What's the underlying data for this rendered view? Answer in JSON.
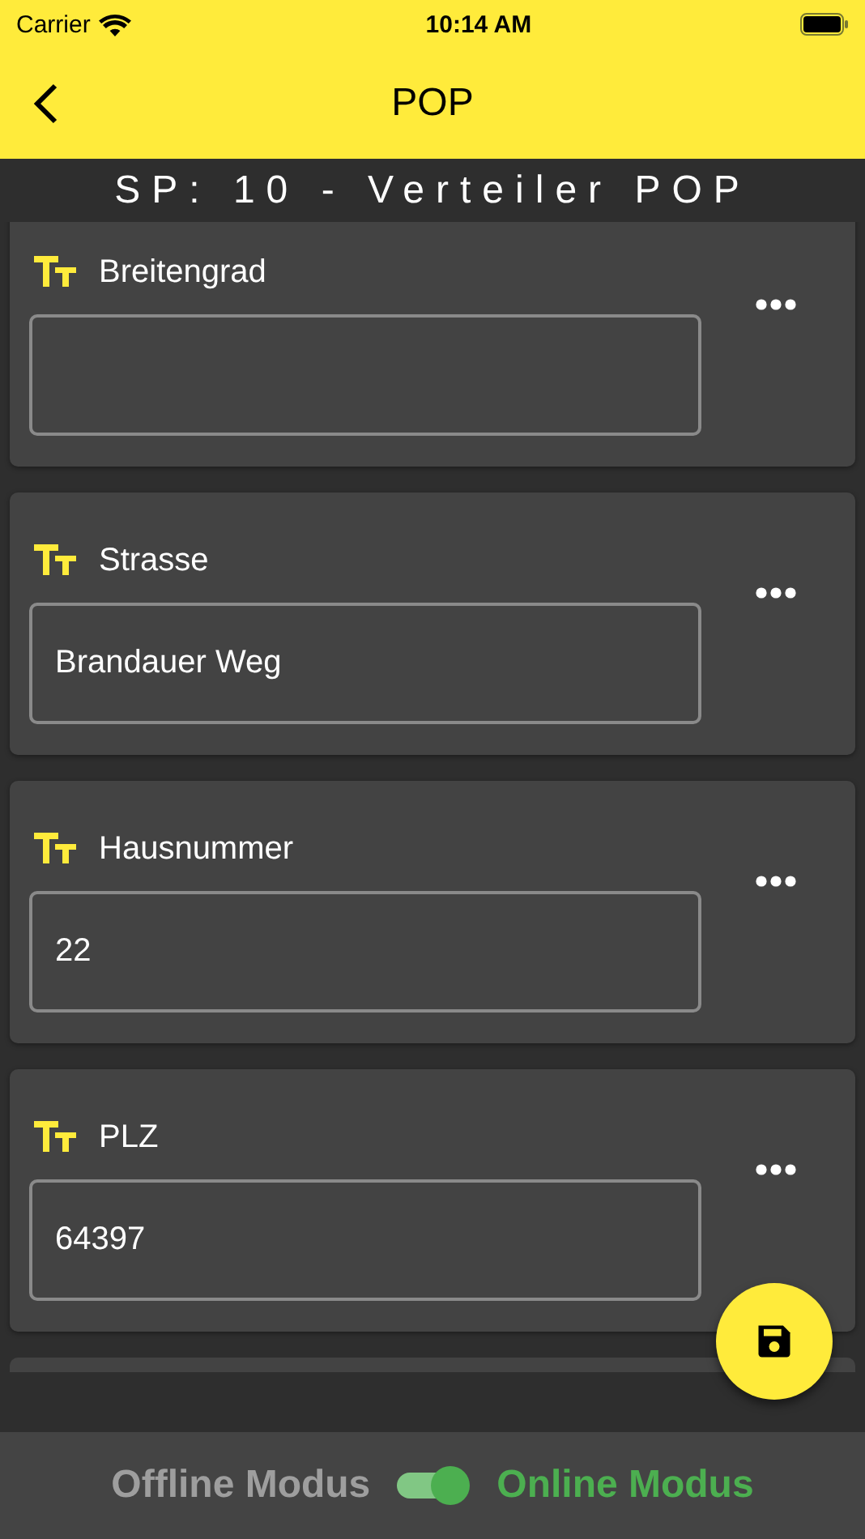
{
  "status_bar": {
    "carrier": "Carrier",
    "time": "10:14 AM"
  },
  "nav": {
    "title": "POP"
  },
  "subtitle": "SP: 10 - Verteiler POP",
  "fields": [
    {
      "label": "Breitengrad"
    },
    {
      "label": "Strasse",
      "value": "Brandauer Weg"
    },
    {
      "label": "Hausnummer",
      "value": "22"
    },
    {
      "label": "PLZ",
      "value": "64397"
    }
  ],
  "mode": {
    "offline_label": "Offline Modus",
    "online_label": "Online Modus",
    "online": true
  }
}
